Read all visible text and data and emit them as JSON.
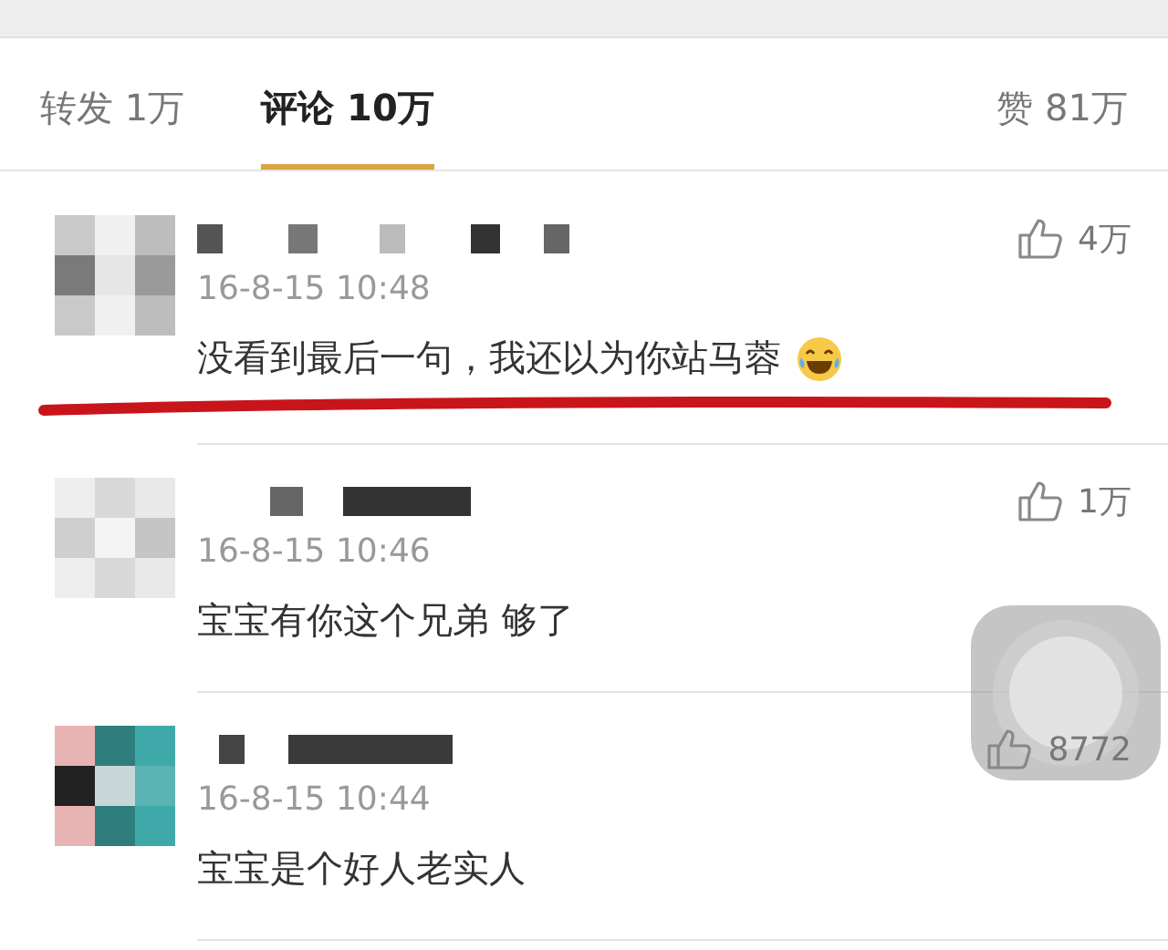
{
  "tabs": [
    {
      "label": "转发",
      "count": "1万",
      "selected": false
    },
    {
      "label": "评论",
      "count": "10万",
      "selected": true
    },
    {
      "label": "赞",
      "count": "81万",
      "selected": false
    }
  ],
  "comments": [
    {
      "time": "16-8-15 10:48",
      "text": "没看到最后一句，我还以为你站马蓉",
      "emoji": true,
      "likes": "4万",
      "highlighted": true
    },
    {
      "time": "16-8-15 10:46",
      "text": "宝宝有你这个兄弟 够了",
      "emoji": false,
      "likes": "1万",
      "highlighted": false
    },
    {
      "time": "16-8-15 10:44",
      "text": "宝宝是个好人老实人",
      "emoji": false,
      "likes": "8772",
      "highlighted": false
    }
  ],
  "floating_button": {
    "kind": "assistive-touch"
  }
}
